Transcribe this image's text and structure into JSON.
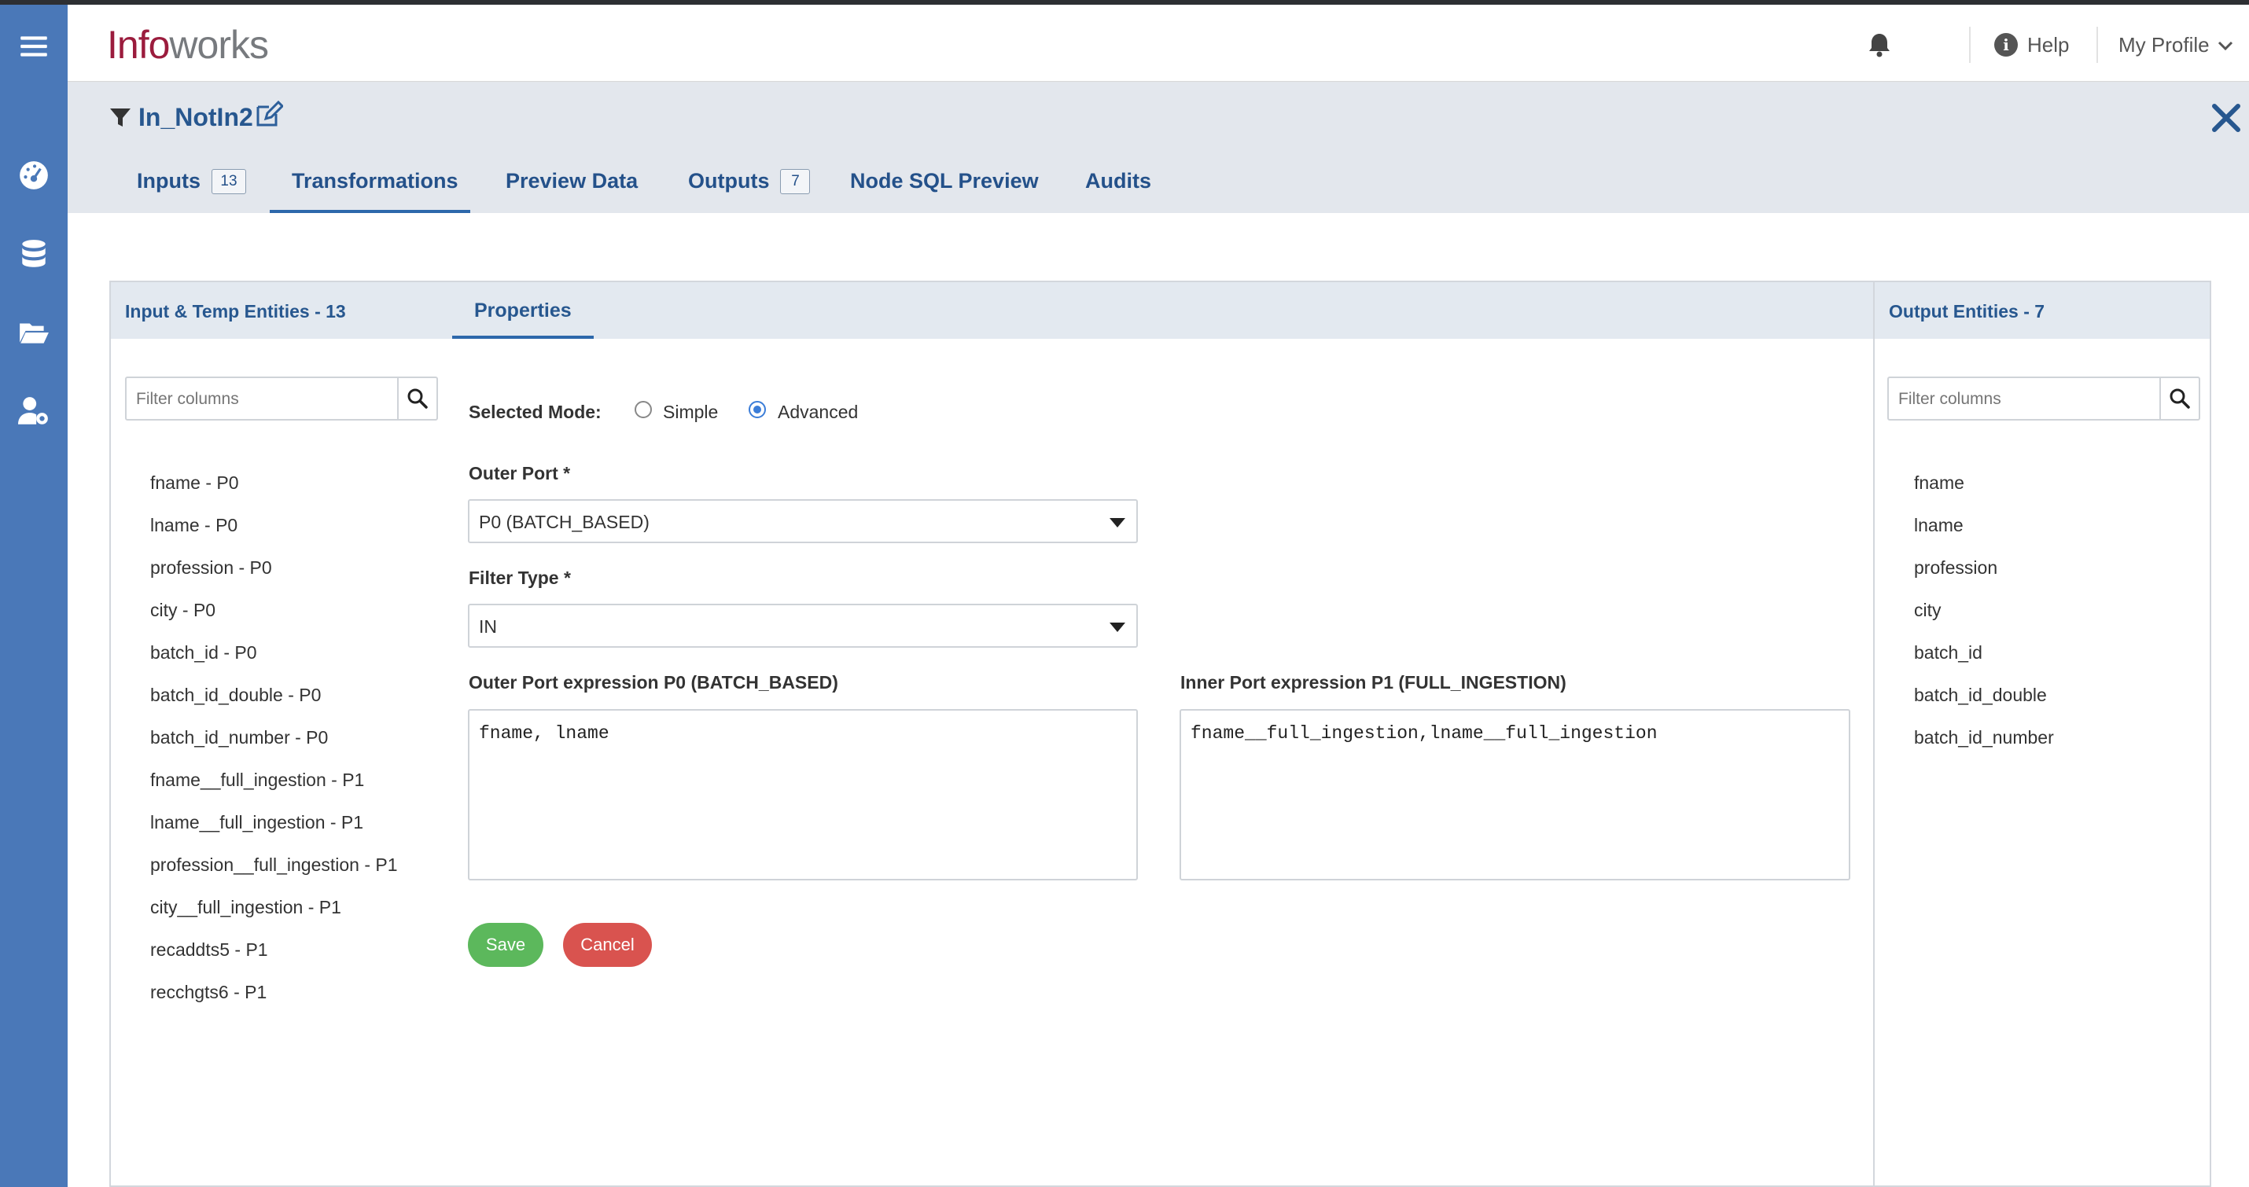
{
  "app": {
    "logo_part1": "Info",
    "logo_part2": "works"
  },
  "header": {
    "help_label": "Help",
    "profile_label": "My Profile"
  },
  "node": {
    "title": "In_NotIn2"
  },
  "tabs": [
    {
      "label": "Inputs",
      "count": "13"
    },
    {
      "label": "Transformations"
    },
    {
      "label": "Preview Data"
    },
    {
      "label": "Outputs",
      "count": "7"
    },
    {
      "label": "Node SQL Preview"
    },
    {
      "label": "Audits"
    }
  ],
  "input_panel": {
    "title": "Input & Temp Entities - 13",
    "filter_placeholder": "Filter columns",
    "columns": [
      "fname - P0",
      "lname - P0",
      "profession - P0",
      "city - P0",
      "batch_id - P0",
      "batch_id_double - P0",
      "batch_id_number - P0",
      "fname__full_ingestion - P1",
      "lname__full_ingestion - P1",
      "profession__full_ingestion - P1",
      "city__full_ingestion - P1",
      "recaddts5 - P1",
      "recchgts6 - P1"
    ]
  },
  "properties": {
    "tab_label": "Properties",
    "mode_label": "Selected Mode:",
    "mode_options": [
      "Simple",
      "Advanced"
    ],
    "mode_selected": "Advanced",
    "outer_port_label": "Outer Port *",
    "outer_port_value": "P0 (BATCH_BASED)",
    "filter_type_label": "Filter Type *",
    "filter_type_value": "IN",
    "outer_expr_label": "Outer Port expression P0 (BATCH_BASED)",
    "outer_expr_value": "fname, lname",
    "inner_expr_label": "Inner Port expression P1 (FULL_INGESTION)",
    "inner_expr_value": "fname__full_ingestion,lname__full_ingestion",
    "save_label": "Save",
    "cancel_label": "Cancel"
  },
  "output_panel": {
    "title": "Output Entities - 7",
    "filter_placeholder": "Filter columns",
    "columns": [
      "fname",
      "lname",
      "profession",
      "city",
      "batch_id",
      "batch_id_double",
      "batch_id_number"
    ]
  },
  "colors": {
    "rail": "#4a78b8",
    "accent": "#27578f",
    "save": "#5cb85c",
    "cancel": "#d9534f",
    "logo": "#9b1c3d"
  },
  "icons": [
    "hamburger-icon",
    "dashboard-icon",
    "database-icon",
    "folder-icon",
    "user-settings-icon",
    "bell-icon",
    "info-icon",
    "chevron-down-icon",
    "filter-icon",
    "edit-icon",
    "close-icon",
    "search-icon"
  ]
}
